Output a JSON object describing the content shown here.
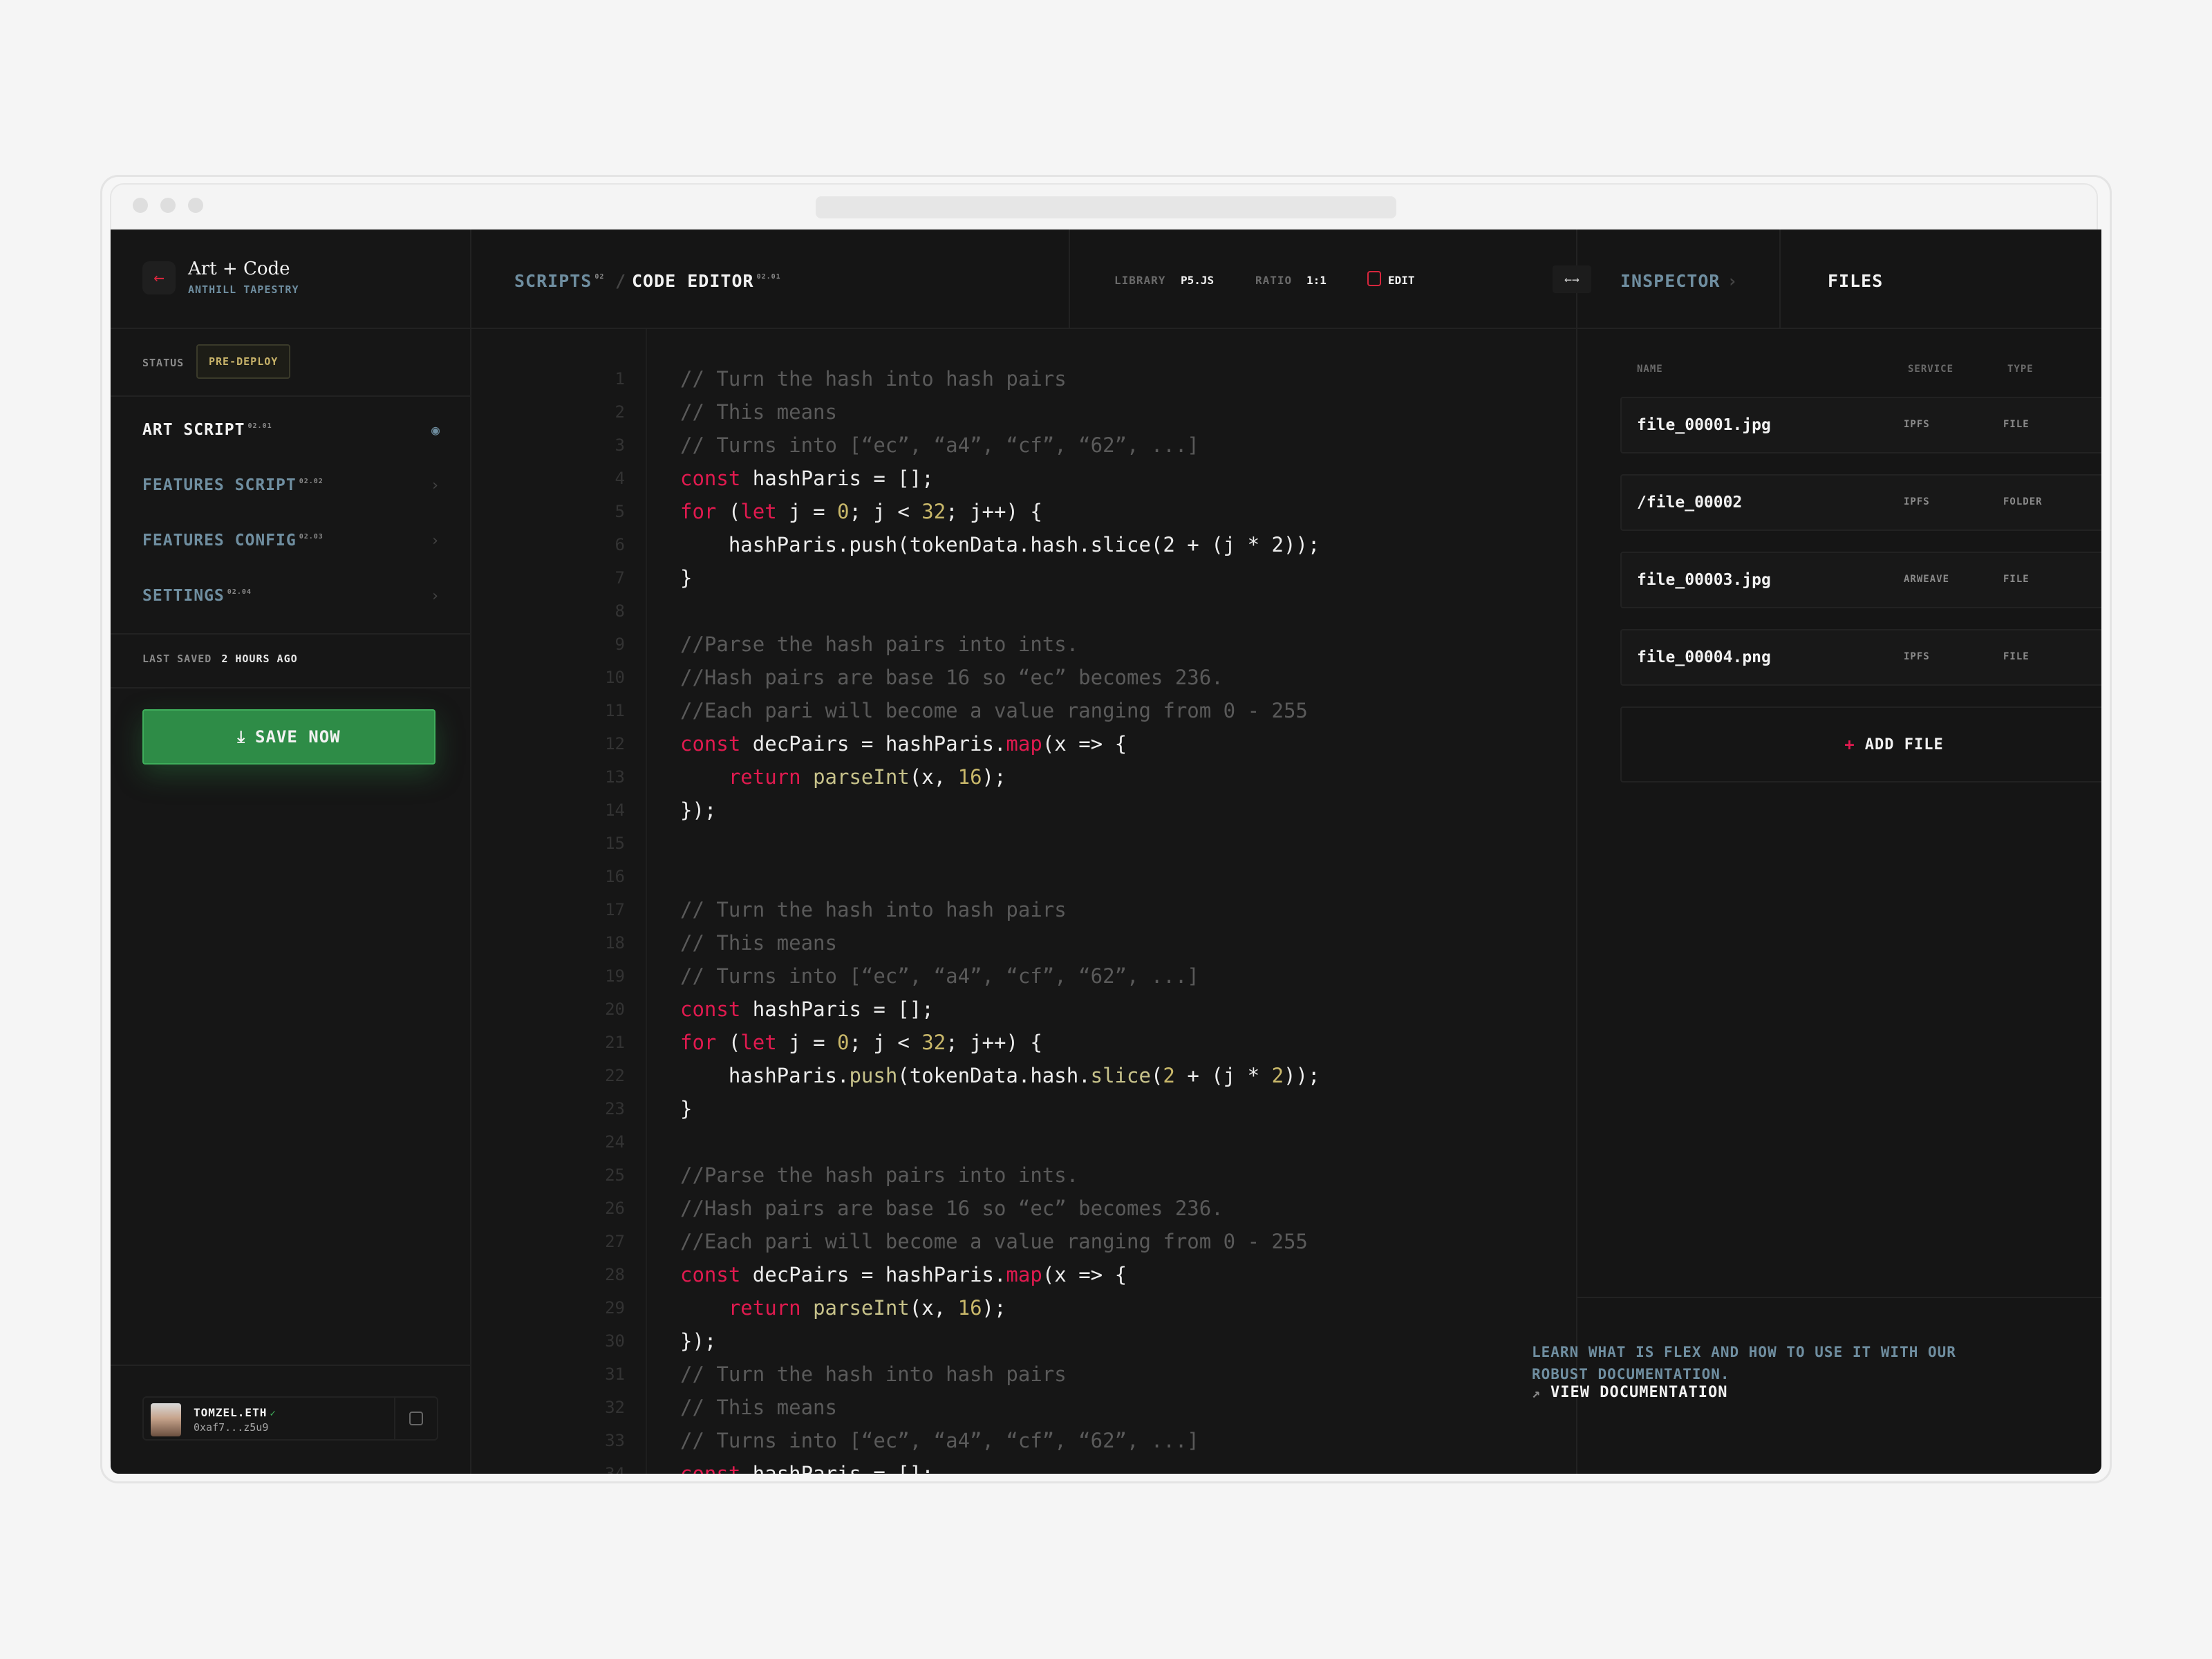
{
  "brand": {
    "title": "Art + Code",
    "subtitle": "ANTHILL TAPESTRY"
  },
  "status": {
    "label": "STATUS",
    "badge": "PRE-DEPLOY"
  },
  "nav": [
    {
      "label": "ART SCRIPT",
      "sup": "02.01",
      "active": true,
      "icon": "eye-icon"
    },
    {
      "label": "FEATURES SCRIPT",
      "sup": "02.02",
      "active": false,
      "icon": "chevron-right-icon"
    },
    {
      "label": "FEATURES CONFIG",
      "sup": "02.03",
      "active": false,
      "icon": "chevron-right-icon"
    },
    {
      "label": "SETTINGS",
      "sup": "02.04",
      "active": false,
      "icon": "chevron-right-icon"
    }
  ],
  "last_saved": {
    "label": "LAST SAVED",
    "value": "2 HOURS AGO"
  },
  "save_button": "SAVE NOW",
  "user": {
    "name": "TOMZEL.ETH",
    "address": "0xaf7...z5u9"
  },
  "header": {
    "scripts": "SCRIPTS",
    "scripts_sup": "02",
    "editor": "CODE EDITOR",
    "editor_sup": "02.01",
    "library_label": "LIBRARY",
    "library_value": "P5.JS",
    "ratio_label": "RATIO",
    "ratio_value": "1:1",
    "edit_label": "EDIT",
    "inspector": "INSPECTOR",
    "files": "FILES"
  },
  "files_table": {
    "headers": {
      "name": "NAME",
      "service": "SERVICE",
      "type": "TYPE"
    },
    "rows": [
      {
        "name": "file_00001.jpg",
        "service": "IPFS",
        "type": "FILE"
      },
      {
        "name": "/file_00002",
        "service": "IPFS",
        "type": "FOLDER"
      },
      {
        "name": "file_00003.jpg",
        "service": "ARWEAVE",
        "type": "FILE"
      },
      {
        "name": "file_00004.png",
        "service": "IPFS",
        "type": "FILE"
      }
    ],
    "add_label": "ADD FILE"
  },
  "docs": {
    "text": "LEARN WHAT IS FLEX AND HOW TO USE IT WITH OUR ROBUST DOCUMENTATION.",
    "link": "VIEW DOCUMENTATION"
  },
  "code_lines": [
    [
      [
        "c",
        "// Turn the hash into hash pairs"
      ]
    ],
    [
      [
        "c",
        "// This means"
      ]
    ],
    [
      [
        "c",
        "// Turns into [“ec”, “a4”, “cf”, “62”, ...]"
      ]
    ],
    [
      [
        "k",
        "const"
      ],
      [
        "i",
        " hashParis = [];"
      ]
    ],
    [
      [
        "k",
        "for"
      ],
      [
        "i",
        " ("
      ],
      [
        "k",
        "let"
      ],
      [
        "i",
        " j = "
      ],
      [
        "n",
        "0"
      ],
      [
        "i",
        "; j < "
      ],
      [
        "n",
        "32"
      ],
      [
        "i",
        "; j++) {"
      ]
    ],
    [
      [
        "i",
        "    hashParis.push(tokenData.hash.slice(2 + (j * 2));"
      ]
    ],
    [
      [
        "i",
        "}"
      ]
    ],
    [],
    [
      [
        "c",
        "//Parse the hash pairs into ints."
      ]
    ],
    [
      [
        "c",
        "//Hash pairs are base 16 so “ec” becomes 236."
      ]
    ],
    [
      [
        "c",
        "//Each pari will become a value ranging from 0 - 255"
      ]
    ],
    [
      [
        "k",
        "const"
      ],
      [
        "i",
        " decPairs = hashParis."
      ],
      [
        "m",
        "map"
      ],
      [
        "i",
        "(x => {"
      ]
    ],
    [
      [
        "k",
        "    return"
      ],
      [
        "i",
        " "
      ],
      [
        "f",
        "parseInt"
      ],
      [
        "i",
        "(x, "
      ],
      [
        "n",
        "16"
      ],
      [
        "i",
        ");"
      ]
    ],
    [
      [
        "i",
        "});"
      ]
    ],
    [],
    [],
    [
      [
        "c",
        "// Turn the hash into hash pairs"
      ]
    ],
    [
      [
        "c",
        "// This means"
      ]
    ],
    [
      [
        "c",
        "// Turns into [“ec”, “a4”, “cf”, “62”, ...]"
      ]
    ],
    [
      [
        "k",
        "const"
      ],
      [
        "i",
        " hashParis = [];"
      ]
    ],
    [
      [
        "k",
        "for"
      ],
      [
        "i",
        " ("
      ],
      [
        "k",
        "let"
      ],
      [
        "i",
        " j = "
      ],
      [
        "n",
        "0"
      ],
      [
        "i",
        "; j < "
      ],
      [
        "n",
        "32"
      ],
      [
        "i",
        "; j++) {"
      ]
    ],
    [
      [
        "i",
        "    hashParis."
      ],
      [
        "f",
        "push"
      ],
      [
        "i",
        "(tokenData.hash."
      ],
      [
        "f",
        "slice"
      ],
      [
        "i",
        "("
      ],
      [
        "n",
        "2"
      ],
      [
        "i",
        " + (j * "
      ],
      [
        "n",
        "2"
      ],
      [
        "i",
        "));"
      ]
    ],
    [
      [
        "i",
        "}"
      ]
    ],
    [],
    [
      [
        "c",
        "//Parse the hash pairs into ints."
      ]
    ],
    [
      [
        "c",
        "//Hash pairs are base 16 so “ec” becomes 236."
      ]
    ],
    [
      [
        "c",
        "//Each pari will become a value ranging from 0 - 255"
      ]
    ],
    [
      [
        "k",
        "const"
      ],
      [
        "i",
        " decPairs = hashParis."
      ],
      [
        "m",
        "map"
      ],
      [
        "i",
        "(x => {"
      ]
    ],
    [
      [
        "k",
        "    return"
      ],
      [
        "i",
        " "
      ],
      [
        "f",
        "parseInt"
      ],
      [
        "i",
        "(x, "
      ],
      [
        "n",
        "16"
      ],
      [
        "i",
        ");"
      ]
    ],
    [
      [
        "i",
        "});"
      ]
    ],
    [
      [
        "c",
        "// Turn the hash into hash pairs"
      ]
    ],
    [
      [
        "c",
        "// This means"
      ]
    ],
    [
      [
        "c",
        "// Turns into [“ec”, “a4”, “cf”, “62”, ...]"
      ]
    ],
    [
      [
        "k",
        "const"
      ],
      [
        "i",
        " hashParis = [];"
      ]
    ]
  ]
}
